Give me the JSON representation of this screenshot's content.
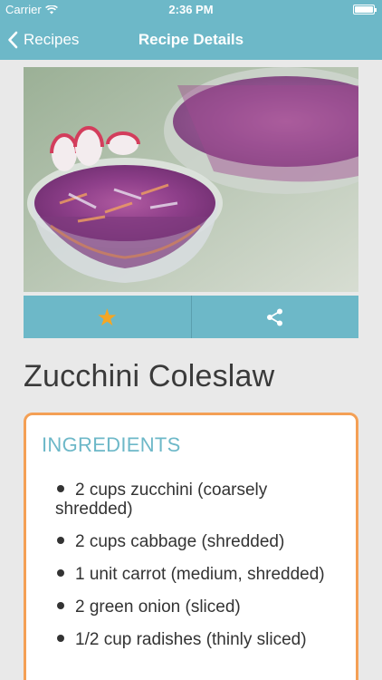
{
  "status": {
    "carrier": "Carrier",
    "time": "2:36 PM"
  },
  "nav": {
    "back_label": "Recipes",
    "title": "Recipe Details"
  },
  "recipe": {
    "title": "Zucchini Coleslaw",
    "ingredients_heading": "INGREDIENTS",
    "ingredients": [
      "2 cups zucchini (coarsely shredded)",
      "2 cups cabbage (shredded)",
      "1 unit carrot (medium, shredded)",
      "2 green onion (sliced)",
      "1/2 cup radishes (thinly sliced)"
    ]
  },
  "colors": {
    "accent": "#6db8c8",
    "star": "#f5a623",
    "card_border": "#f4a055"
  },
  "icons": {
    "back": "chevron-left-icon",
    "favorite": "star-icon",
    "share": "share-icon"
  }
}
